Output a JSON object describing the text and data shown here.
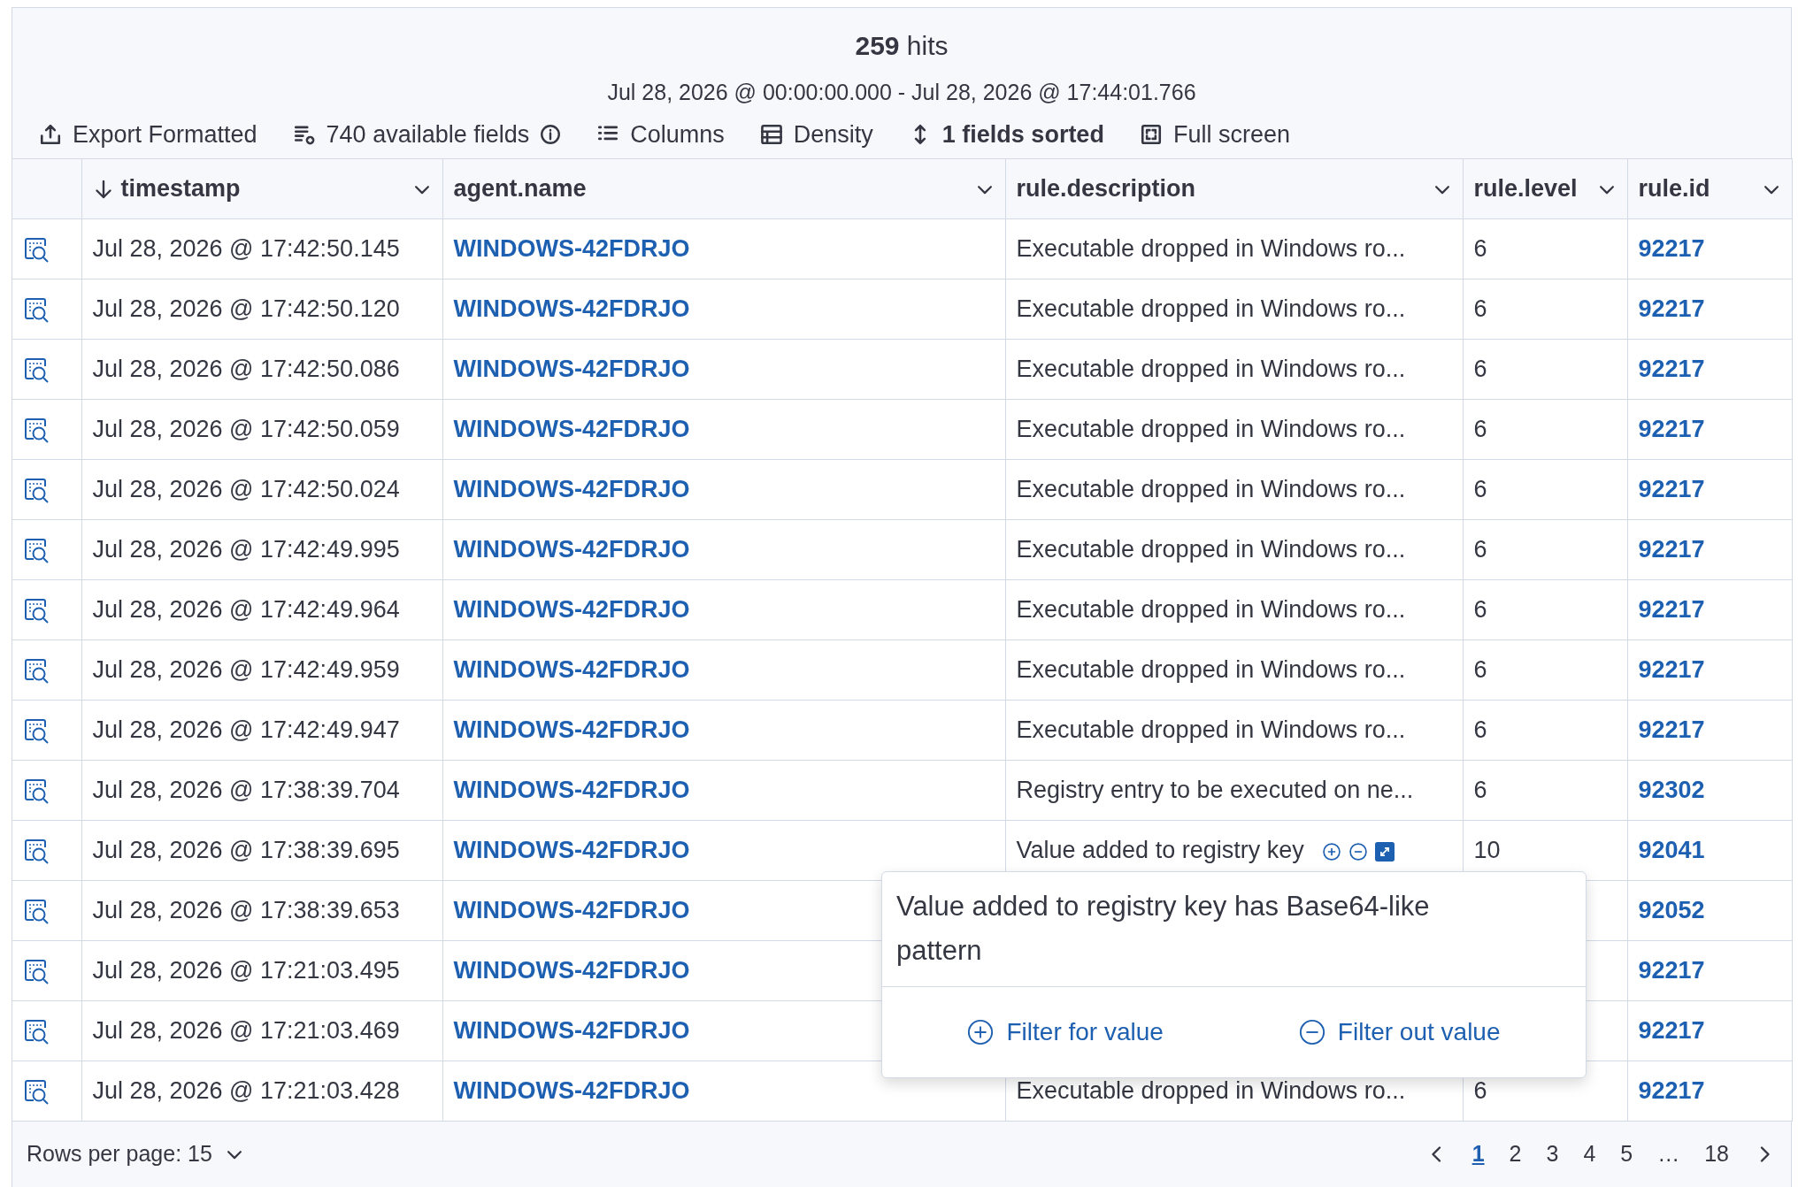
{
  "summary": {
    "hits_count": "259",
    "hits_label": "hits",
    "time_range": "Jul 28, 2026 @ 00:00:00.000 - Jul 28, 2026 @ 17:44:01.766"
  },
  "toolbar": [
    {
      "kind": "export",
      "label": "Export Formatted"
    },
    {
      "kind": "fields",
      "label": "740 available fields"
    },
    {
      "kind": "columns",
      "label": "Columns"
    },
    {
      "kind": "density",
      "label": "Density"
    },
    {
      "kind": "sort",
      "label": "1 fields sorted"
    },
    {
      "kind": "fullscreen",
      "label": "Full screen"
    }
  ],
  "columns": [
    {
      "label": "timestamp",
      "sorted": true
    },
    {
      "label": "agent.name",
      "sorted": false
    },
    {
      "label": "rule.description",
      "sorted": false
    },
    {
      "label": "rule.level",
      "sorted": false
    },
    {
      "label": "rule.id",
      "sorted": false
    }
  ],
  "rows": [
    {
      "timestamp": "Jul 28, 2026 @ 17:42:50.145",
      "agent": "WINDOWS-42FDRJO",
      "description": "Executable dropped in Windows ro...",
      "level": "6",
      "rule_id": "92217",
      "cell_actions": false
    },
    {
      "timestamp": "Jul 28, 2026 @ 17:42:50.120",
      "agent": "WINDOWS-42FDRJO",
      "description": "Executable dropped in Windows ro...",
      "level": "6",
      "rule_id": "92217",
      "cell_actions": false
    },
    {
      "timestamp": "Jul 28, 2026 @ 17:42:50.086",
      "agent": "WINDOWS-42FDRJO",
      "description": "Executable dropped in Windows ro...",
      "level": "6",
      "rule_id": "92217",
      "cell_actions": false
    },
    {
      "timestamp": "Jul 28, 2026 @ 17:42:50.059",
      "agent": "WINDOWS-42FDRJO",
      "description": "Executable dropped in Windows ro...",
      "level": "6",
      "rule_id": "92217",
      "cell_actions": false
    },
    {
      "timestamp": "Jul 28, 2026 @ 17:42:50.024",
      "agent": "WINDOWS-42FDRJO",
      "description": "Executable dropped in Windows ro...",
      "level": "6",
      "rule_id": "92217",
      "cell_actions": false
    },
    {
      "timestamp": "Jul 28, 2026 @ 17:42:49.995",
      "agent": "WINDOWS-42FDRJO",
      "description": "Executable dropped in Windows ro...",
      "level": "6",
      "rule_id": "92217",
      "cell_actions": false
    },
    {
      "timestamp": "Jul 28, 2026 @ 17:42:49.964",
      "agent": "WINDOWS-42FDRJO",
      "description": "Executable dropped in Windows ro...",
      "level": "6",
      "rule_id": "92217",
      "cell_actions": false
    },
    {
      "timestamp": "Jul 28, 2026 @ 17:42:49.959",
      "agent": "WINDOWS-42FDRJO",
      "description": "Executable dropped in Windows ro...",
      "level": "6",
      "rule_id": "92217",
      "cell_actions": false
    },
    {
      "timestamp": "Jul 28, 2026 @ 17:42:49.947",
      "agent": "WINDOWS-42FDRJO",
      "description": "Executable dropped in Windows ro...",
      "level": "6",
      "rule_id": "92217",
      "cell_actions": false
    },
    {
      "timestamp": "Jul 28, 2026 @ 17:38:39.704",
      "agent": "WINDOWS-42FDRJO",
      "description": "Registry entry to be executed on ne...",
      "level": "6",
      "rule_id": "92302",
      "cell_actions": false
    },
    {
      "timestamp": "Jul 28, 2026 @ 17:38:39.695",
      "agent": "WINDOWS-42FDRJO",
      "description": "Value added to registry key",
      "level": "10",
      "rule_id": "92041",
      "cell_actions": true
    },
    {
      "timestamp": "Jul 28, 2026 @ 17:38:39.653",
      "agent": "WINDOWS-42FDRJO",
      "rule_id": "92052"
    },
    {
      "timestamp": "Jul 28, 2026 @ 17:21:03.495",
      "agent": "WINDOWS-42FDRJO",
      "rule_id": "92217"
    },
    {
      "timestamp": "Jul 28, 2026 @ 17:21:03.469",
      "agent": "WINDOWS-42FDRJO",
      "rule_id": "92217"
    },
    {
      "timestamp": "Jul 28, 2026 @ 17:21:03.428",
      "agent": "WINDOWS-42FDRJO",
      "description": "Executable dropped in Windows ro...",
      "level": "6",
      "rule_id": "92217",
      "cell_actions": false
    }
  ],
  "popover": {
    "text": "Value added to registry key has Base64-like pattern",
    "actions": [
      {
        "kind": "filter_in",
        "label": "Filter for value"
      },
      {
        "kind": "filter_out",
        "label": "Filter out value"
      }
    ]
  },
  "footer": {
    "rows_per_page": "Rows per page: 15",
    "pages": [
      {
        "label": "1",
        "selected": true
      },
      {
        "label": "2",
        "selected": false
      },
      {
        "label": "3",
        "selected": false
      },
      {
        "label": "4",
        "selected": false
      },
      {
        "label": "5",
        "selected": false
      },
      {
        "label": "…",
        "selected": false
      },
      {
        "label": "18",
        "selected": false
      }
    ]
  }
}
